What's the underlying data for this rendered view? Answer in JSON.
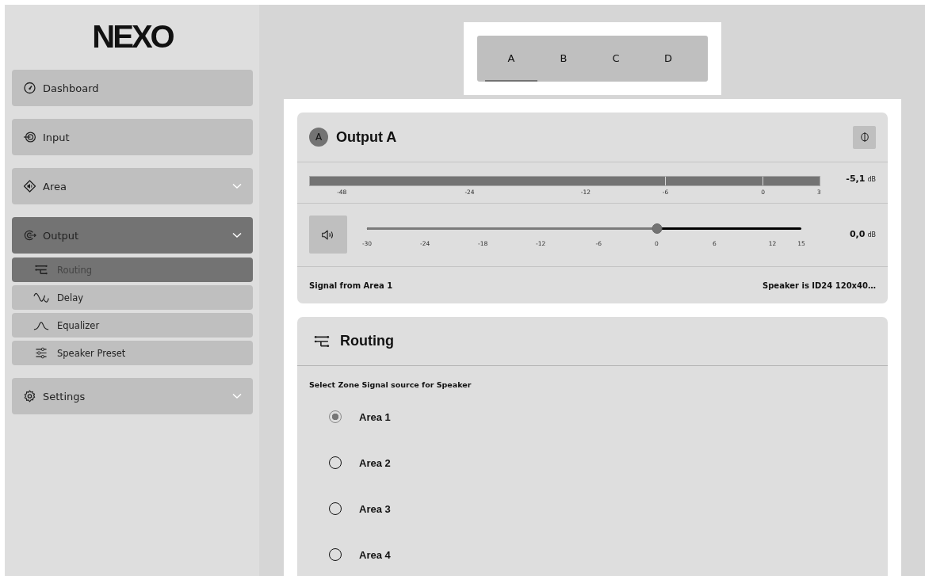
{
  "logo": "NEXO",
  "sidebar": {
    "items": [
      {
        "label": "Dashboard",
        "kind": "link",
        "selected": false
      },
      {
        "label": "Input",
        "kind": "link",
        "selected": false
      },
      {
        "label": "Area",
        "kind": "group",
        "selected": false
      },
      {
        "label": "Output",
        "kind": "group",
        "selected": true,
        "expanded": true,
        "children": [
          {
            "label": "Routing",
            "selected": true
          },
          {
            "label": "Delay",
            "selected": false
          },
          {
            "label": "Equalizer",
            "selected": false
          },
          {
            "label": "Speaker Preset",
            "selected": false
          }
        ]
      },
      {
        "label": "Settings",
        "kind": "group",
        "selected": false
      }
    ]
  },
  "tabs": [
    {
      "label": "A",
      "selected": true
    },
    {
      "label": "B",
      "selected": false
    },
    {
      "label": "C",
      "selected": false
    },
    {
      "label": "D",
      "selected": false
    }
  ],
  "output_card": {
    "badge": "A",
    "title": "Output A",
    "meter": {
      "level": 1,
      "reading": "-5,1",
      "unit": "dB",
      "ticks": [
        "-48",
        "-24",
        "-12",
        "-6",
        "0",
        "3"
      ]
    },
    "volume": {
      "level": 0.667,
      "reading": "0,0",
      "unit": "dB",
      "ticks": [
        "-30",
        "-24",
        "-18",
        "-12",
        "-6",
        "0",
        "6",
        "12",
        "15"
      ]
    },
    "signal": "Signal from Area 1",
    "speaker": "Speaker is ID24 120x40…"
  },
  "routing_card": {
    "title": "Routing",
    "prompt": "Select Zone Signal source for Speaker",
    "options": [
      {
        "label": "Area 1",
        "selected": true
      },
      {
        "label": "Area 2",
        "selected": false
      },
      {
        "label": "Area 3",
        "selected": false
      },
      {
        "label": "Area 4",
        "selected": false
      }
    ]
  }
}
